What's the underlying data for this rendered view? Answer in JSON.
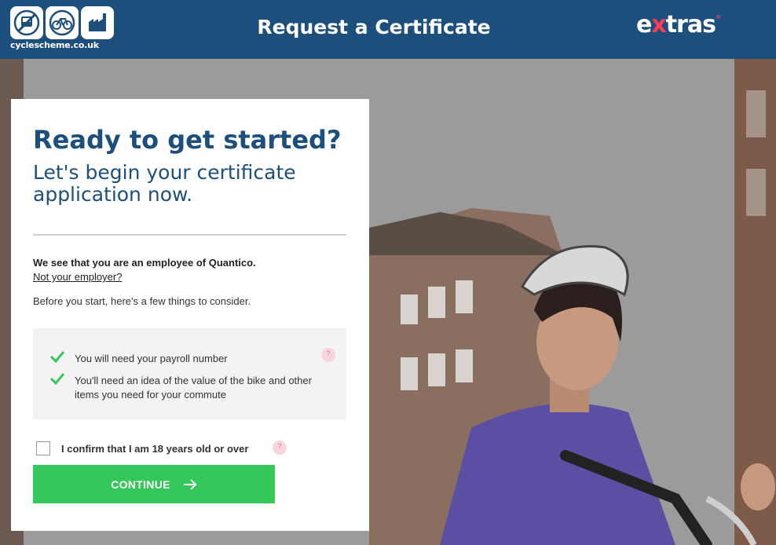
{
  "header": {
    "brand_text": "cyclescheme.co.uk",
    "title": "Request a Certificate",
    "extras_logo": {
      "pre": "e",
      "x": "x",
      "post": "tras"
    }
  },
  "card": {
    "heading": "Ready to get started?",
    "subheading": "Let's begin your certificate application now.",
    "employee_text": "We see that you are an employee of Quantico.",
    "not_employer_link": "Not your employer?",
    "before_text": "Before you start, here's a few things to consider.",
    "checklist": [
      "You will need your payroll number",
      "You'll need an idea of the value of the bike and other items you need for your commute"
    ],
    "help_glyph": "?",
    "confirm_label": "I confirm that I am 18 years old or over",
    "confirm_checked": false,
    "continue_label": "CONTINUE"
  },
  "colors": {
    "header_bg": "#1d4f7c",
    "accent_green": "#34c759",
    "title_blue": "#1d4f7c",
    "extras_x": "#ff3b57"
  },
  "icons": [
    "train-icon",
    "bicycle-icon",
    "factory-icon",
    "check-icon",
    "help-icon",
    "arrow-right-icon"
  ]
}
